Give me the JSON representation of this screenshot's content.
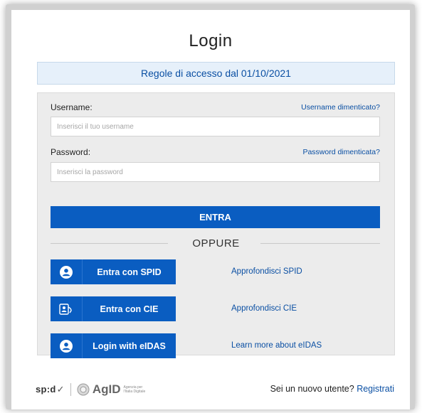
{
  "login": {
    "title": "Login",
    "rules_link": "Regole di accesso dal 01/10/2021",
    "username_label": "Username:",
    "username_forgot": "Username dimenticato?",
    "username_placeholder": "Inserisci il tuo username",
    "password_label": "Password:",
    "password_forgot": "Password dimenticata?",
    "password_placeholder": "Inserisci la password",
    "submit_label": "ENTRA",
    "divider_label": "OPPURE"
  },
  "auth_options": [
    {
      "label": "Entra con SPID",
      "icon": "user-icon",
      "learn_more": "Approfondisci SPID"
    },
    {
      "label": "Entra con CIE",
      "icon": "id-card-icon",
      "learn_more": "Approfondisci CIE"
    },
    {
      "label": "Login with eIDAS",
      "icon": "user-icon",
      "learn_more": "Learn more about eIDAS"
    }
  ],
  "footer": {
    "spid_logo": "sp:d",
    "agid_logo": "AgID",
    "agid_subtitle": "Agenzia per l'Italia Digitale",
    "new_user_text": "Sei un nuovo utente?",
    "register_link": "Registrati"
  },
  "colors": {
    "primary": "#0a5dc1",
    "link": "#0a4fa3",
    "rules_bg": "#e6f0fa",
    "panel_bg": "#ececec"
  }
}
